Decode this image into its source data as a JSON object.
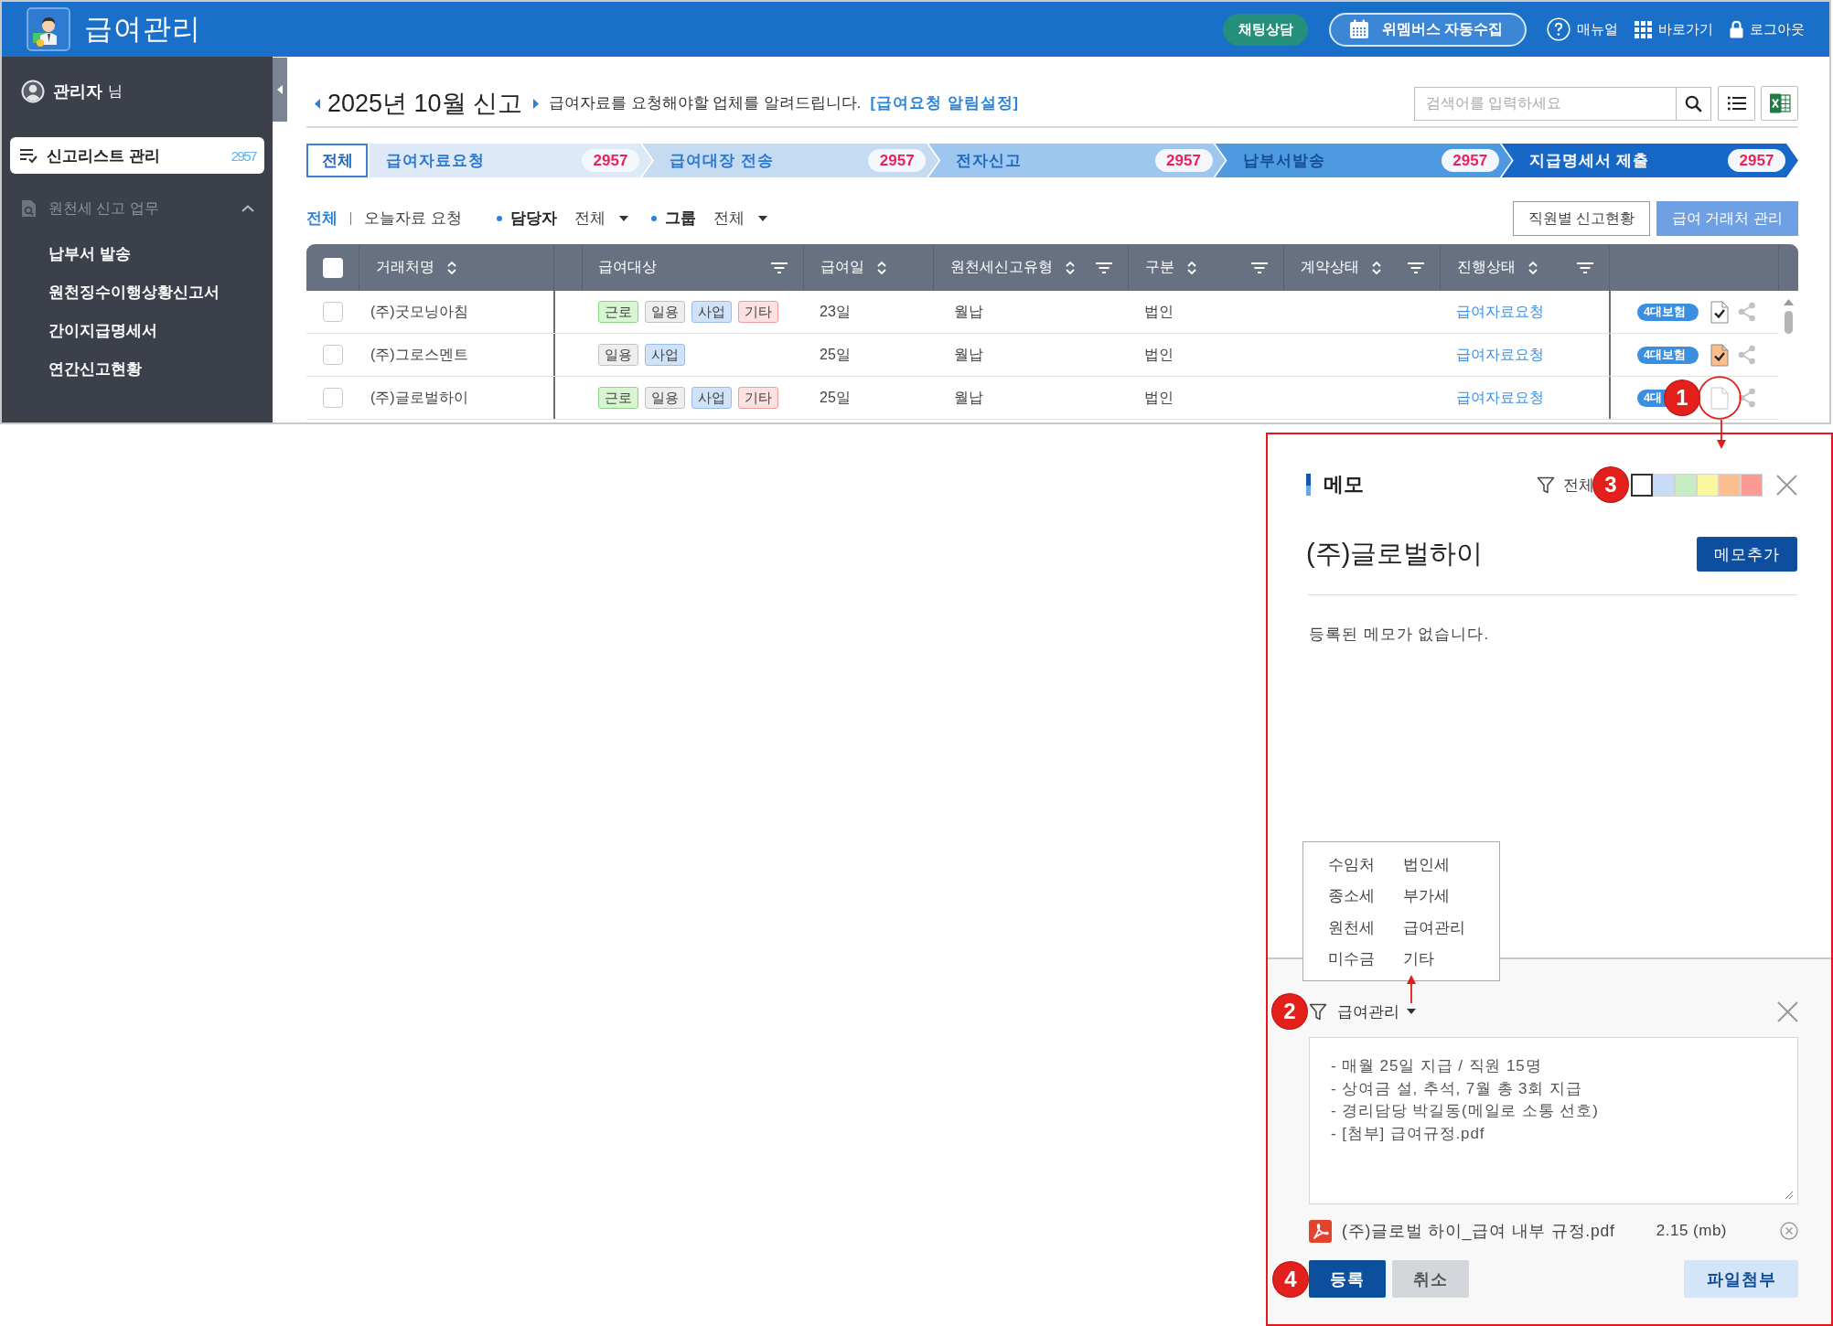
{
  "header": {
    "title": "급여관리",
    "buttons": [
      {
        "label": "채팅상담",
        "kind": "chat"
      },
      {
        "label": "위멤버스 자동수집",
        "kind": "collect"
      }
    ],
    "links": [
      {
        "label": "매뉴얼",
        "kind": "help"
      },
      {
        "label": "바로가기",
        "kind": "shortcuts"
      },
      {
        "label": "로그아웃",
        "kind": "logout"
      }
    ]
  },
  "sidebar": {
    "user": {
      "name": "관리자",
      "suffix": "님"
    },
    "items": [
      {
        "label": "신고리스트 관리",
        "count": "2957",
        "selected": true
      }
    ],
    "section": {
      "label": "원천세 신고 업무",
      "expanded": true,
      "children": [
        {
          "label": "납부서 발송",
          "selected": false
        },
        {
          "label": "원천징수이행상황신고서",
          "selected": false
        },
        {
          "label": "간이지급명세서",
          "selected": false
        },
        {
          "label": "연간신고현황",
          "selected": false
        }
      ]
    }
  },
  "page": {
    "title": "2025년 10월 신고",
    "description": "급여자료를 요청해야할 업체를 알려드립니다.",
    "link": "[급여요청 알림설정]",
    "search": {
      "placeholder": "검색어를 입력하세요"
    }
  },
  "steps": [
    {
      "label": "전체",
      "kind": "all",
      "selected": true
    },
    {
      "label": "급여자료요청",
      "count": "2957",
      "kind": "step",
      "selected": false
    },
    {
      "label": "급여대장 전송",
      "count": "2957",
      "kind": "step",
      "selected": false
    },
    {
      "label": "전자신고",
      "count": "2957",
      "kind": "step",
      "selected": false
    },
    {
      "label": "납부서발송",
      "count": "2957",
      "kind": "step",
      "selected": false
    },
    {
      "label": "지급명세서 제출",
      "count": "2957",
      "kind": "step",
      "selected": false
    }
  ],
  "filters": {
    "quick": [
      {
        "label": "전체",
        "selected": true
      },
      {
        "label": "오늘자료 요청",
        "selected": false
      }
    ],
    "dropdowns": [
      {
        "label": "담당자",
        "value": "전체"
      },
      {
        "label": "그룹",
        "value": "전체"
      }
    ],
    "buttons": [
      {
        "label": "직원별 신고현황",
        "kind": "outline"
      },
      {
        "label": "급여 거래처 관리",
        "kind": "primary"
      }
    ]
  },
  "table": {
    "columns": [
      {
        "kind": "checkbox",
        "checked": false
      },
      {
        "kind": "text",
        "label": "거래처명",
        "sortable": true,
        "filterable": false
      },
      {
        "kind": "split",
        "label": "급여대상",
        "sortable": false,
        "filterable": true
      },
      {
        "kind": "text",
        "label": "급여일",
        "sortable": true,
        "filterable": false
      },
      {
        "kind": "text",
        "label": "원천세신고유형",
        "sortable": true,
        "filterable": true
      },
      {
        "kind": "text",
        "label": "구분",
        "sortable": true,
        "filterable": true
      },
      {
        "kind": "text",
        "label": "계약상태",
        "sortable": true,
        "filterable": true
      },
      {
        "kind": "text",
        "label": "진행상태",
        "sortable": true,
        "filterable": true
      },
      {
        "kind": "blank"
      }
    ],
    "rows": [
      {
        "checked": false,
        "company": "(주)굿모닝아침",
        "targets": [
          {
            "label": "근로",
            "kind": "work"
          },
          {
            "label": "일용",
            "kind": "daily"
          },
          {
            "label": "사업",
            "kind": "business"
          },
          {
            "label": "기타",
            "kind": "other"
          }
        ],
        "pay_day": "23일",
        "report_type": "월납",
        "category": "법인",
        "status": "급여자료요청",
        "badge": "4대보험",
        "memo": {
          "kind": "written",
          "color": "#ffffff",
          "highlighted": false
        }
      },
      {
        "checked": false,
        "company": "(주)그로스멘트",
        "targets": [
          {
            "label": "일용",
            "kind": "daily"
          },
          {
            "label": "사업",
            "kind": "business"
          }
        ],
        "pay_day": "25일",
        "report_type": "월납",
        "category": "법인",
        "status": "급여자료요청",
        "badge": "4대보험",
        "memo": {
          "kind": "written",
          "color": "#fbbf8c",
          "highlighted": false
        }
      },
      {
        "checked": false,
        "company": "(주)글로벌하이",
        "targets": [
          {
            "label": "근로",
            "kind": "work"
          },
          {
            "label": "일용",
            "kind": "daily"
          },
          {
            "label": "사업",
            "kind": "business"
          },
          {
            "label": "기타",
            "kind": "other"
          }
        ],
        "pay_day": "25일",
        "report_type": "월납",
        "category": "법인",
        "status": "급여자료요청",
        "badge": "4대",
        "memo": {
          "kind": "blank",
          "highlighted": true,
          "callout": "1"
        }
      }
    ]
  },
  "memo_panel": {
    "title": "메모",
    "filter": {
      "label": "전체",
      "callout": "3"
    },
    "swatches": [
      {
        "color": "#ffffff",
        "selected": true
      },
      {
        "color": "#c8dcf7",
        "selected": false
      },
      {
        "color": "#c6ecc2",
        "selected": false
      },
      {
        "color": "#fbf79c",
        "selected": false
      },
      {
        "color": "#fdbf8e",
        "selected": false
      },
      {
        "color": "#fb9b93",
        "selected": false
      }
    ],
    "company": "(주)글로벌하이",
    "add_button": "메모추가",
    "empty_message": "등록된 메모가 없습니다.",
    "category_menu": {
      "open": true,
      "options": [
        {
          "label": "수임처"
        },
        {
          "label": "법인세"
        },
        {
          "label": "종소세"
        },
        {
          "label": "부가세"
        },
        {
          "label": "원천세"
        },
        {
          "label": "급여관리"
        },
        {
          "label": "미수금"
        },
        {
          "label": "기타"
        }
      ]
    },
    "editor": {
      "category": "급여관리",
      "callout": "2",
      "text": "- 매월 25일 지급 / 직원 15명\n- 상여금 설, 추석, 7월 총 3회 지급\n- 경리담당 박길동(메일로 소통 선호)\n- [첨부] 급여규정.pdf",
      "attachment": {
        "name": "(주)글로벌 하이_급여 내부 규정.pdf",
        "size": "2.15 (mb)"
      },
      "buttons": [
        {
          "label": "등록",
          "kind": "primary",
          "callout": "4"
        },
        {
          "label": "취소",
          "kind": "secondary"
        },
        {
          "label": "파일첨부",
          "kind": "attach"
        }
      ]
    }
  }
}
